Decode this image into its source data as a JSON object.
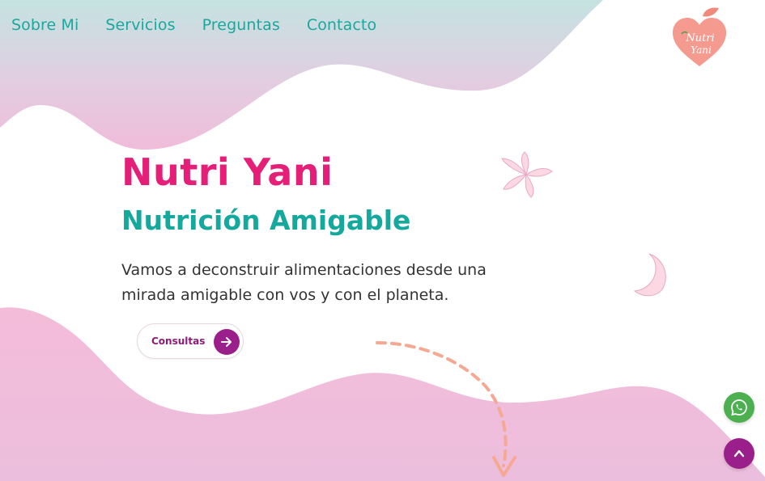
{
  "nav": {
    "items": [
      {
        "label": "Sobre Mi"
      },
      {
        "label": "Servicios"
      },
      {
        "label": "Preguntas"
      },
      {
        "label": "Contacto"
      }
    ]
  },
  "logo": {
    "line1": "Nutri",
    "line2": "Yani"
  },
  "hero": {
    "title": "Nutri Yani",
    "subtitle": "Nutrición Amigable",
    "description": "Vamos a deconstruir alimentaciones desde una mirada amigable con vos y con el planeta.",
    "cta_label": "Consultas"
  },
  "icons": {
    "cta": "arrow-right-icon",
    "whatsapp": "whatsapp-icon",
    "scroll_top": "chevron-up-icon",
    "flower": "flower-icon",
    "moon": "moon-icon",
    "scroll_down": "dashed-arrow-icon"
  },
  "colors": {
    "brand_pink": "#e51f78",
    "brand_teal": "#15a89d",
    "accent_purple": "#9b1f8a",
    "whatsapp_green": "#4caf50",
    "wave_pink": "#f0b5d6"
  }
}
